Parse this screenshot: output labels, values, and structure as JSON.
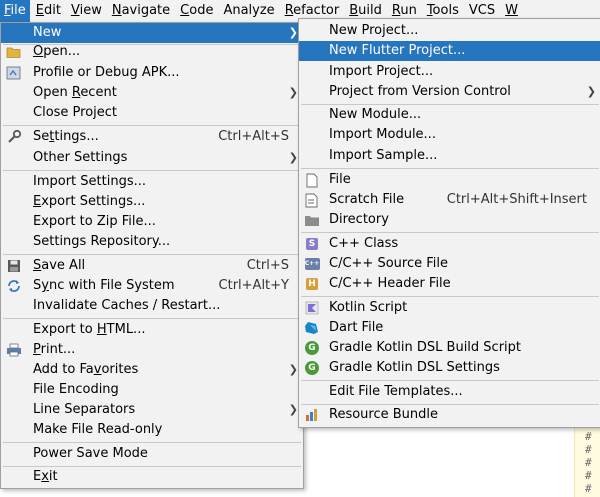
{
  "menubar": {
    "items": [
      {
        "mnemonic": "F",
        "rest": "ile"
      },
      {
        "mnemonic": "E",
        "rest": "dit"
      },
      {
        "mnemonic": "V",
        "rest": "iew"
      },
      {
        "mnemonic": "N",
        "rest": "avigate"
      },
      {
        "mnemonic": "C",
        "rest": "ode"
      },
      {
        "mnemonic": "",
        "rest": "Analyze"
      },
      {
        "mnemonic": "R",
        "rest": "efactor"
      },
      {
        "mnemonic": "B",
        "rest": "uild"
      },
      {
        "mnemonic": "R",
        "rest": "un"
      },
      {
        "mnemonic": "T",
        "rest": "ools"
      },
      {
        "mnemonic": "",
        "rest": "VCS"
      },
      {
        "mnemonic": "W",
        "rest": ""
      }
    ]
  },
  "file_menu": {
    "new": {
      "label": "New"
    },
    "open": {
      "pre": "",
      "mn": "O",
      "post": "pen..."
    },
    "profile": {
      "label": "Profile or Debug APK..."
    },
    "open_recent": {
      "pre": "Open ",
      "mn": "R",
      "post": "ecent"
    },
    "close_project": {
      "label": "Close Project"
    },
    "settings": {
      "pre": "Se",
      "mn": "t",
      "post": "tings...",
      "shortcut": "Ctrl+Alt+S"
    },
    "other_settings": {
      "label": "Other Settings"
    },
    "import_settings": {
      "label": "Import Settings..."
    },
    "export_settings": {
      "pre": "",
      "mn": "E",
      "post": "xport Settings..."
    },
    "export_zip": {
      "label": "Export to Zip File..."
    },
    "settings_repo": {
      "label": "Settings Repository..."
    },
    "save_all": {
      "pre": "",
      "mn": "S",
      "post": "ave All",
      "shortcut": "Ctrl+S"
    },
    "sync": {
      "pre": "S",
      "mn": "y",
      "post": "nc with File System",
      "shortcut": "Ctrl+Alt+Y"
    },
    "invalidate": {
      "label": "Invalidate Caches / Restart..."
    },
    "export_html": {
      "pre": "Export to ",
      "mn": "H",
      "post": "TML..."
    },
    "print": {
      "pre": "",
      "mn": "P",
      "post": "rint..."
    },
    "add_favorites": {
      "pre": "Add to Fa",
      "mn": "v",
      "post": "orites"
    },
    "file_encoding": {
      "label": "File Encoding"
    },
    "line_separators": {
      "label": "Line Separators"
    },
    "read_only": {
      "label": "Make File Read-only"
    },
    "power_save": {
      "label": "Power Save Mode"
    },
    "exit": {
      "pre": "E",
      "mn": "x",
      "post": "it"
    }
  },
  "new_menu": {
    "new_project": {
      "label": "New Project..."
    },
    "new_flutter": {
      "label": "New Flutter Project..."
    },
    "import_project": {
      "label": "Import Project..."
    },
    "from_vcs": {
      "label": "Project from Version Control"
    },
    "new_module": {
      "label": "New Module..."
    },
    "import_module": {
      "label": "Import Module..."
    },
    "import_sample": {
      "label": "Import Sample..."
    },
    "file": {
      "label": "File"
    },
    "scratch": {
      "label": "Scratch File",
      "shortcut": "Ctrl+Alt+Shift+Insert"
    },
    "directory": {
      "label": "Directory"
    },
    "cpp_class": {
      "label": "C++ Class",
      "icon_text": "S"
    },
    "cpp_source": {
      "label": "C/C++ Source File",
      "icon_text": "C++"
    },
    "cpp_header": {
      "label": "C/C++ Header File",
      "icon_text": "H"
    },
    "kotlin_script": {
      "label": "Kotlin Script"
    },
    "dart_file": {
      "label": "Dart File"
    },
    "gradle_build": {
      "label": "Gradle Kotlin DSL Build Script",
      "icon_text": "G"
    },
    "gradle_settings": {
      "label": "Gradle Kotlin DSL Settings",
      "icon_text": "G"
    },
    "edit_templates": {
      "label": "Edit File Templates..."
    },
    "resource_bundle": {
      "label": "Resource Bundle"
    }
  },
  "colors": {
    "highlight": "#2675bf",
    "menu_bg": "#f2f2f2",
    "gradle": "#4a9a3a",
    "dart": "#1a84c9",
    "kotlin": "#7b6fd8"
  },
  "editor": {
    "gutter_marks": [
      "#",
      "#",
      "#",
      "#",
      "#"
    ]
  }
}
